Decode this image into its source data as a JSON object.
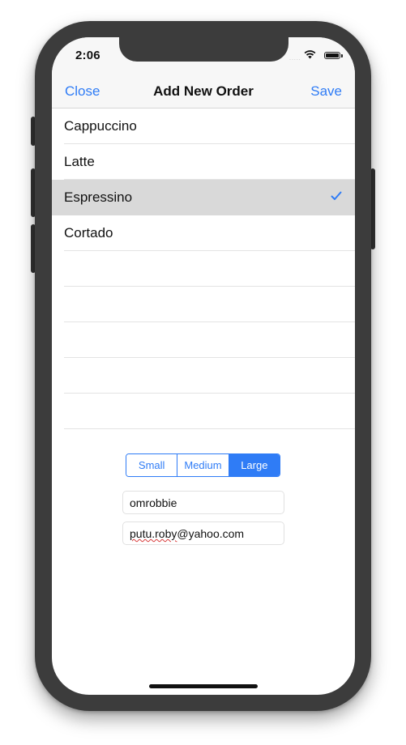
{
  "status_bar": {
    "time": "2:06",
    "signal_dots": "....."
  },
  "navbar": {
    "close_label": "Close",
    "title": "Add New Order",
    "save_label": "Save"
  },
  "coffee_list": {
    "items": [
      {
        "label": "Cappuccino",
        "selected": false
      },
      {
        "label": "Latte",
        "selected": false
      },
      {
        "label": "Espressino",
        "selected": true
      },
      {
        "label": "Cortado",
        "selected": false
      }
    ]
  },
  "size_selector": {
    "options": [
      "Small",
      "Medium",
      "Large"
    ],
    "selected": "Large"
  },
  "form": {
    "name_value": "omrobbie",
    "email_user_part": "putu.roby",
    "email_domain_part": "@yahoo.com"
  },
  "icons": {
    "checkmark": "checkmark-icon",
    "wifi": "wifi-icon",
    "battery": "battery-icon"
  },
  "colors": {
    "accent": "#2f7cf6",
    "selected_row": "#d9d9d9",
    "device_frame": "#3c3c3c"
  }
}
